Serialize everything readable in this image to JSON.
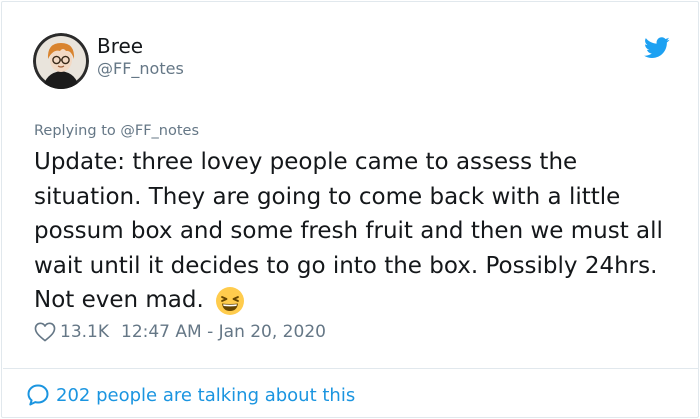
{
  "author": {
    "name": "Bree",
    "handle": "@FF_notes"
  },
  "reply": {
    "prefix": "Replying to ",
    "handle": "@FF_notes"
  },
  "tweet": {
    "text": "Update: three lovey people came to assess the situation. They are going to come back with a little possum box and some fresh fruit and then we must all wait until it decides to go into the box. Possibly 24hrs. Not even mad.",
    "emoji": "grinning-squinting-face"
  },
  "meta": {
    "likes": "13.1K",
    "timestamp": "12:47 AM - Jan 20, 2020"
  },
  "footer": {
    "talking": "202 people are talking about this"
  },
  "colors": {
    "twitter_blue": "#1da1f2",
    "link_blue": "#1b95e0",
    "muted": "#657786",
    "text": "#14171a",
    "border": "#e1e8ed"
  },
  "icons": {
    "brand": "twitter-bird-icon",
    "like": "heart-icon",
    "conversation": "speech-bubble-icon"
  }
}
